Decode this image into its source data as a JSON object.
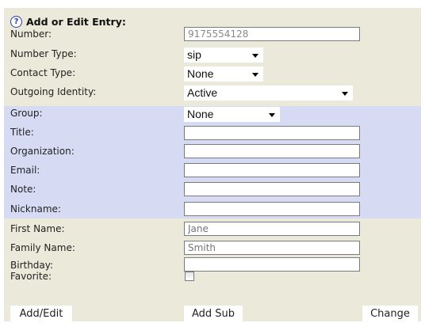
{
  "form": {
    "title": "Add or Edit Entry:",
    "fields": {
      "number": {
        "label": "Number:",
        "value": "9175554128"
      },
      "number_type": {
        "label": "Number Type:",
        "value": "sip"
      },
      "contact_type": {
        "label": "Contact Type:",
        "value": "None"
      },
      "outgoing_identity": {
        "label": "Outgoing Identity:",
        "value": "Active"
      },
      "group": {
        "label": "Group:",
        "value": "None"
      },
      "title": {
        "label": "Title:",
        "value": ""
      },
      "organization": {
        "label": "Organization:",
        "value": ""
      },
      "email": {
        "label": "Email:",
        "value": ""
      },
      "note": {
        "label": "Note:",
        "value": ""
      },
      "nickname": {
        "label": "Nickname:",
        "value": ""
      },
      "first_name": {
        "label": "First Name:",
        "placeholder": "Jane"
      },
      "family_name": {
        "label": "Family Name:",
        "placeholder": "Smith"
      },
      "birthday": {
        "label": "Birthday:",
        "value": ""
      },
      "favorite": {
        "label": "Favorite:",
        "checked": false
      }
    },
    "buttons": {
      "add_edit": "Add/Edit",
      "add_sub": "Add Sub",
      "change": "Change"
    }
  },
  "colors": {
    "panel_bg": "#ebe9da",
    "group_band_bg": "#d6dbf3"
  },
  "icons": {
    "help": "question-circle-icon"
  }
}
